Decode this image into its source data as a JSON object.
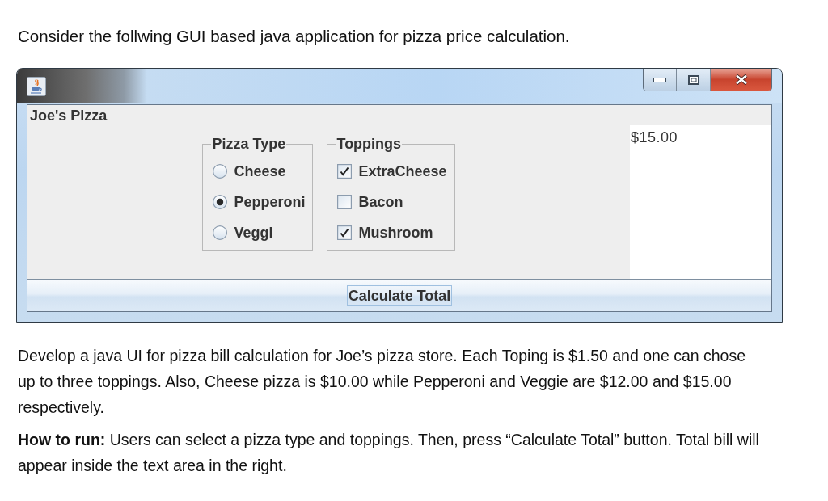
{
  "intro": "Consider the follwing GUI based java application for pizza price calculation.",
  "window": {
    "label": "Joe's Pizza",
    "groups": [
      {
        "title": "Pizza Type",
        "kind": "radio",
        "options": [
          {
            "label": "Cheese",
            "selected": false
          },
          {
            "label": "Pepperoni",
            "selected": true
          },
          {
            "label": "Veggi",
            "selected": false
          }
        ]
      },
      {
        "title": "Toppings",
        "kind": "checkbox",
        "options": [
          {
            "label": "ExtraCheese",
            "checked": true
          },
          {
            "label": "Bacon",
            "checked": false
          },
          {
            "label": "Mushroom",
            "checked": true
          }
        ]
      }
    ],
    "output": {
      "value": "$15.00"
    },
    "button": {
      "label": "Calculate Total",
      "focused": true
    }
  },
  "paragraphs": [
    "Develop a java UI for pizza bill calculation for Joe’s pizza store. Each Toping is $1.50 and one can chose up to three toppings. Also, Cheese pizza is $10.00 while Pepperoni and Veggie are $12.00 and $15.00 respectively.",
    "**How to run:** Users can select a pizza type and toppings. Then, press “Calculate Total” button. Total bill will appear inside the text area in the right."
  ]
}
